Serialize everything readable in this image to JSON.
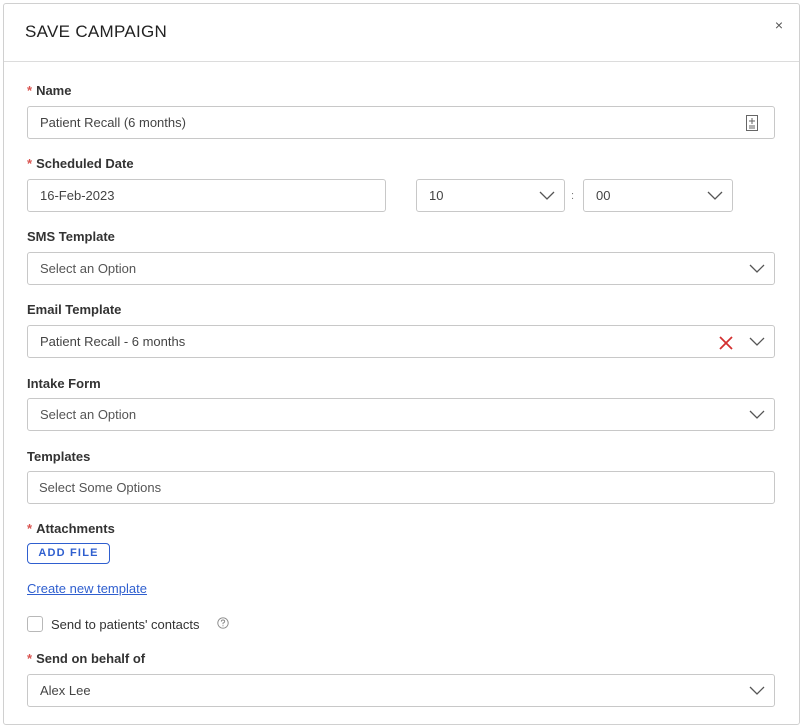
{
  "dialog": {
    "title": "SAVE CAMPAIGN",
    "close_label": "×"
  },
  "name": {
    "label": "Name",
    "required_mark": "*",
    "value": "Patient Recall (6 months)",
    "icon": "document-icon"
  },
  "scheduled_date": {
    "label": "Scheduled Date",
    "required_mark": "*",
    "date_value": "16-Feb-2023",
    "hour_value": "10",
    "minute_value": "00",
    "separator": ":"
  },
  "sms_template": {
    "label": "SMS Template",
    "placeholder": "Select an Option"
  },
  "email_template": {
    "label": "Email Template",
    "value": "Patient Recall - 6 months",
    "clear_icon": "clear-x-icon"
  },
  "intake_form": {
    "label": "Intake Form",
    "placeholder": "Select an Option"
  },
  "templates": {
    "label": "Templates",
    "placeholder": "Select Some Options"
  },
  "attachments": {
    "label": "Attachments",
    "required_mark": "*",
    "button_label": "ADD FILE"
  },
  "create_template_link": "Create new template",
  "send_to_contacts": {
    "label": "Send to patients' contacts",
    "checked": false
  },
  "send_on_behalf": {
    "label": "Send on behalf of",
    "required_mark": "*",
    "value": "Alex Lee"
  },
  "colors": {
    "accent": "#2f5fcf",
    "required": "#d9534f",
    "clear": "#d32f2f"
  }
}
